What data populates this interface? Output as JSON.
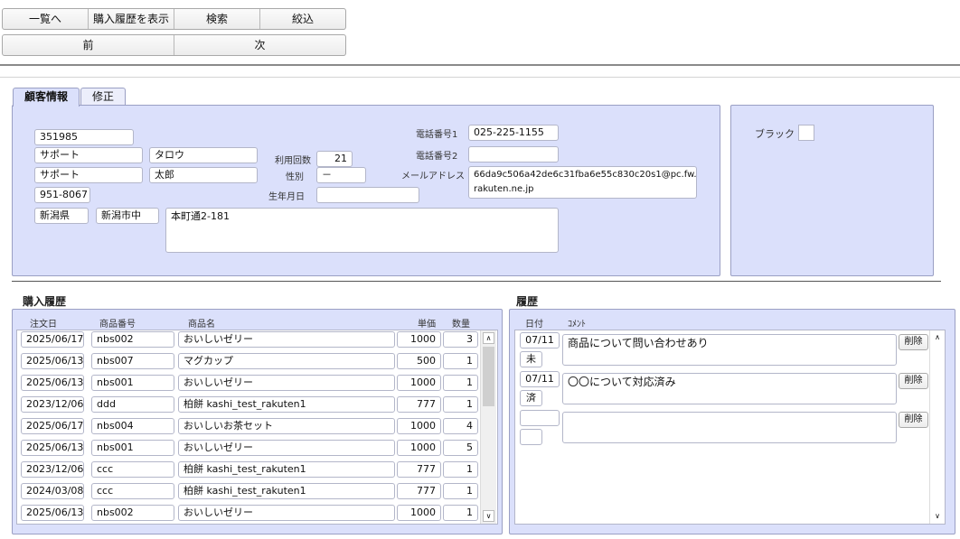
{
  "toolbar": {
    "row1": [
      "一覧へ",
      "購入履歴を表示",
      "検索",
      "絞込"
    ],
    "row2": [
      "前",
      "次"
    ]
  },
  "tabs": {
    "customer": "顧客情報",
    "edit": "修正"
  },
  "customer": {
    "id": "351985",
    "last_name": "サポート",
    "first_name_kana": "タロウ",
    "last_name2": "サポート",
    "first_name": "太郎",
    "zip": "951-8067",
    "prefecture": "新潟県",
    "city": "新潟市中",
    "address": "本町通2-181",
    "usage_label": "利用回数",
    "usage_count": "21",
    "gender_label": "性別",
    "gender": "－",
    "birthday_label": "生年月日",
    "birthday": "",
    "phone1_label": "電話番号1",
    "phone1": "025-225-1155",
    "phone2_label": "電話番号2",
    "phone2": "",
    "email_label": "メールアドレス",
    "email_line1": "66da9c506a42de6c31fba6e55c830c20s1@pc.fw.",
    "email_line2": "rakuten.ne.jp"
  },
  "black": {
    "label": "ブラック"
  },
  "purchase": {
    "title": "購入履歴",
    "headers": {
      "date": "注文日",
      "code": "商品番号",
      "name": "商品名",
      "price": "単価",
      "qty": "数量"
    },
    "rows": [
      {
        "date": "2025/06/17",
        "code": "nbs002",
        "name": "おいしいゼリー",
        "price": "1000",
        "qty": "3"
      },
      {
        "date": "2025/06/13",
        "code": "nbs007",
        "name": "マグカップ",
        "price": "500",
        "qty": "1"
      },
      {
        "date": "2025/06/13",
        "code": "nbs001",
        "name": "おいしいゼリー",
        "price": "1000",
        "qty": "1"
      },
      {
        "date": "2023/12/06",
        "code": "ddd",
        "name": "柏餅 kashi_test_rakuten1",
        "price": "777",
        "qty": "1"
      },
      {
        "date": "2025/06/17",
        "code": "nbs004",
        "name": "おいしいお茶セット",
        "price": "1000",
        "qty": "4"
      },
      {
        "date": "2025/06/13",
        "code": "nbs001",
        "name": "おいしいゼリー",
        "price": "1000",
        "qty": "5"
      },
      {
        "date": "2023/12/06",
        "code": "ccc",
        "name": "柏餅 kashi_test_rakuten1",
        "price": "777",
        "qty": "1"
      },
      {
        "date": "2024/03/08",
        "code": "ccc",
        "name": "柏餅 kashi_test_rakuten1",
        "price": "777",
        "qty": "1"
      },
      {
        "date": "2025/06/13",
        "code": "nbs002",
        "name": "おいしいゼリー",
        "price": "1000",
        "qty": "1"
      }
    ]
  },
  "history": {
    "title": "履歴",
    "headers": {
      "date": "日付",
      "comment": "ｺﾒﾝﾄ"
    },
    "delete_label": "削除",
    "rows": [
      {
        "date": "07/11",
        "status": "未",
        "comment": "商品について問い合わせあり"
      },
      {
        "date": "07/11",
        "status": "済",
        "comment": "〇〇について対応済み"
      },
      {
        "date": "",
        "status": "",
        "comment": ""
      }
    ]
  }
}
